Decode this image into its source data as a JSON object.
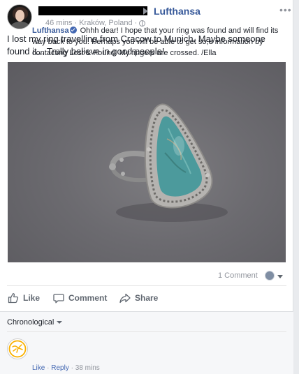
{
  "post": {
    "page_name": "Lufthansa",
    "time": "46 mins",
    "separator": "·",
    "location": "Kraków, Poland",
    "separator2": "·",
    "more_label": "•••",
    "text": "I lost my ring travelling from Cracow to Munich. Maybe someone found it... Trully believe in good people!",
    "comments_count": "1 Comment"
  },
  "actions": {
    "like": "Like",
    "comment": "Comment",
    "share": "Share"
  },
  "comments": {
    "sort_label": "Chronological",
    "items": [
      {
        "author": "Lufthansa",
        "text": "Ohhh dear! I hope that your ring was found and will find its way back to you. Perhaps you will be able to get so,e information by contacting Lost & Found. My fingers are crossed. /Ella",
        "like_label": "Like",
        "dot": "·",
        "reply_label": "Reply",
        "dot2": "·",
        "time": "38 mins"
      }
    ]
  },
  "colors": {
    "link_blue": "#365899",
    "verified_blue": "#4267b2",
    "lufthansa_yellow": "#f9b000",
    "muted_gray": "#90949c"
  },
  "icons": [
    "globe-icon",
    "like-icon",
    "comment-icon",
    "share-icon",
    "verified-icon",
    "lufthansa-crane-logo",
    "more-dots-icon"
  ]
}
